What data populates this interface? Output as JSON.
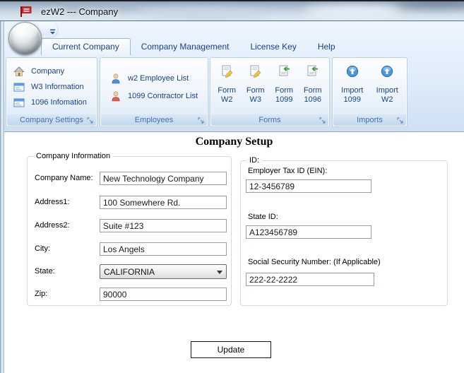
{
  "window": {
    "title": "ezW2 --- Company"
  },
  "tabs": [
    {
      "label": "Current Company",
      "active": true
    },
    {
      "label": "Company Management",
      "active": false
    },
    {
      "label": "License Key",
      "active": false
    },
    {
      "label": "Help",
      "active": false
    }
  ],
  "ribbon": {
    "groups": [
      {
        "caption": "Company Settings",
        "items": [
          {
            "label": "Company",
            "icon": "house-icon"
          },
          {
            "label": "W3 Information",
            "icon": "form-card-icon"
          },
          {
            "label": "1096 Infomation",
            "icon": "form-card-icon"
          }
        ]
      },
      {
        "caption": "Employees",
        "items": [
          {
            "label": "w2 Employee List",
            "icon": "person-blue-icon"
          },
          {
            "label": "1099 Contractor List",
            "icon": "person-red-icon"
          }
        ]
      },
      {
        "caption": "Forms",
        "items": [
          {
            "line1": "Form",
            "line2": "W2",
            "icon": "document-pencil-icon"
          },
          {
            "line1": "Form",
            "line2": "W3",
            "icon": "document-pencil-icon"
          },
          {
            "line1": "Form",
            "line2": "1099",
            "icon": "document-arrow-icon"
          },
          {
            "line1": "Form",
            "line2": "1096",
            "icon": "document-arrow-icon"
          }
        ]
      },
      {
        "caption": "Imports",
        "items": [
          {
            "line1": "Import",
            "line2": "1099",
            "icon": "import-up-icon"
          },
          {
            "line1": "Import",
            "line2": "W2",
            "icon": "import-up-icon"
          }
        ]
      }
    ]
  },
  "content": {
    "heading": "Company Setup",
    "company_info": {
      "legend": "Company Information",
      "fields": [
        {
          "label": "Company Name:",
          "value": "New Technology Company"
        },
        {
          "label": "Address1:",
          "value": "100 Somewhere Rd."
        },
        {
          "label": "Address2:",
          "value": "Suite #123"
        },
        {
          "label": "City:",
          "value": "Los Angels"
        },
        {
          "label": "State:",
          "value": "CALIFORNIA",
          "type": "select"
        },
        {
          "label": "Zip:",
          "value": "90000"
        }
      ]
    },
    "ids": {
      "legend": "ID:",
      "fields": [
        {
          "label": "Employer Tax ID (EIN):",
          "value": "12-3456789"
        },
        {
          "label": "State ID:",
          "value": "A123456789"
        },
        {
          "label": "Social Security Number: (If Applicable)",
          "value": "222-22-2222"
        }
      ]
    },
    "update_button": "Update"
  },
  "colors": {
    "tab_text": "#15428b",
    "ribbon_label_text": "#15428b",
    "group_caption_text": "#3f6fb5",
    "app_icon_red": "#da2222",
    "employee_icon_blue": "#4a90d9",
    "contractor_icon_red": "#dd6055",
    "import_icon_blue": "#4a97dd",
    "pencil_icon_yellow": "#f4c23c",
    "arrow_icon_green": "#3a9a3a"
  }
}
